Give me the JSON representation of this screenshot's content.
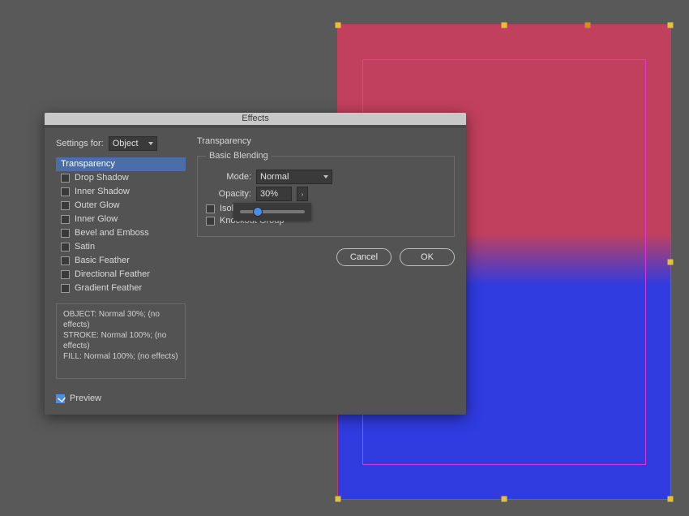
{
  "dialog": {
    "title": "Effects",
    "settings_for_label": "Settings for:",
    "settings_for_value": "Object",
    "panel_heading": "Transparency",
    "effects": [
      {
        "label": "Transparency",
        "checked": null,
        "selected": true
      },
      {
        "label": "Drop Shadow",
        "checked": false
      },
      {
        "label": "Inner Shadow",
        "checked": false
      },
      {
        "label": "Outer Glow",
        "checked": false
      },
      {
        "label": "Inner Glow",
        "checked": false
      },
      {
        "label": "Bevel and Emboss",
        "checked": false
      },
      {
        "label": "Satin",
        "checked": false
      },
      {
        "label": "Basic Feather",
        "checked": false
      },
      {
        "label": "Directional Feather",
        "checked": false
      },
      {
        "label": "Gradient Feather",
        "checked": false
      }
    ],
    "summary": {
      "object": "OBJECT: Normal 30%; (no effects)",
      "stroke": "STROKE: Normal 100%; (no effects)",
      "fill": "FILL: Normal 100%; (no effects)"
    },
    "preview_label": "Preview",
    "preview_checked": true,
    "blending": {
      "legend": "Basic Blending",
      "mode_label": "Mode:",
      "mode_value": "Normal",
      "opacity_label": "Opacity:",
      "opacity_value": "30%",
      "isolate_label": "Isolate Blending",
      "isolate_label_visible": "Isolat",
      "isolate_checked": false,
      "knockout_label": "Knockout Group",
      "knockout_checked": false,
      "slider_percent": 30
    },
    "buttons": {
      "cancel": "Cancel",
      "ok": "OK"
    }
  }
}
